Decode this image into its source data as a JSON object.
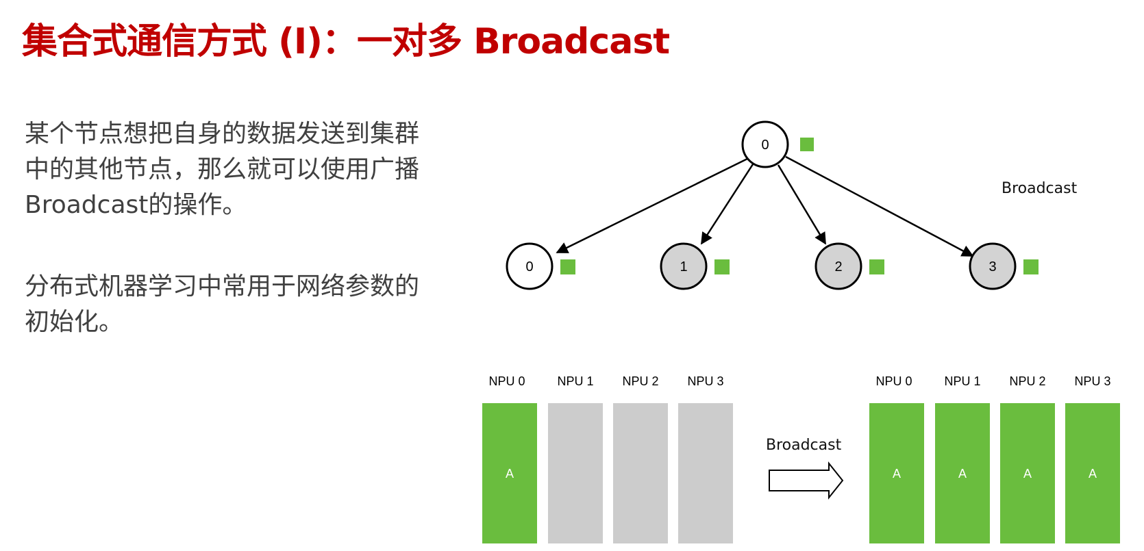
{
  "title": "集合式通信方式 (I)：一对多 Broadcast",
  "paragraphs": [
    "某个节点想把自身的数据发送到集群中的其他节点，那么就可以使用广播Broadcast的操作。",
    "分布式机器学习中常用于网络参数的初始化。"
  ],
  "colors": {
    "title": "#c00000",
    "data_green": "#6abd3e",
    "inactive_gray": "#cccccc",
    "node_gray": "#d3d3d3"
  },
  "tree": {
    "label": "Broadcast",
    "root": {
      "label": "0",
      "filled": false,
      "has_data": true
    },
    "children": [
      {
        "label": "0",
        "filled": false,
        "has_data": true
      },
      {
        "label": "1",
        "filled": true,
        "has_data": true
      },
      {
        "label": "2",
        "filled": true,
        "has_data": true
      },
      {
        "label": "3",
        "filled": true,
        "has_data": true
      }
    ]
  },
  "buffers": {
    "arrow_label": "Broadcast",
    "before": [
      {
        "label": "NPU 0",
        "content": "A",
        "has_data": true
      },
      {
        "label": "NPU 1",
        "content": "",
        "has_data": false
      },
      {
        "label": "NPU 2",
        "content": "",
        "has_data": false
      },
      {
        "label": "NPU 3",
        "content": "",
        "has_data": false
      }
    ],
    "after": [
      {
        "label": "NPU 0",
        "content": "A",
        "has_data": true
      },
      {
        "label": "NPU 1",
        "content": "A",
        "has_data": true
      },
      {
        "label": "NPU 2",
        "content": "A",
        "has_data": true
      },
      {
        "label": "NPU 3",
        "content": "A",
        "has_data": true
      }
    ]
  }
}
